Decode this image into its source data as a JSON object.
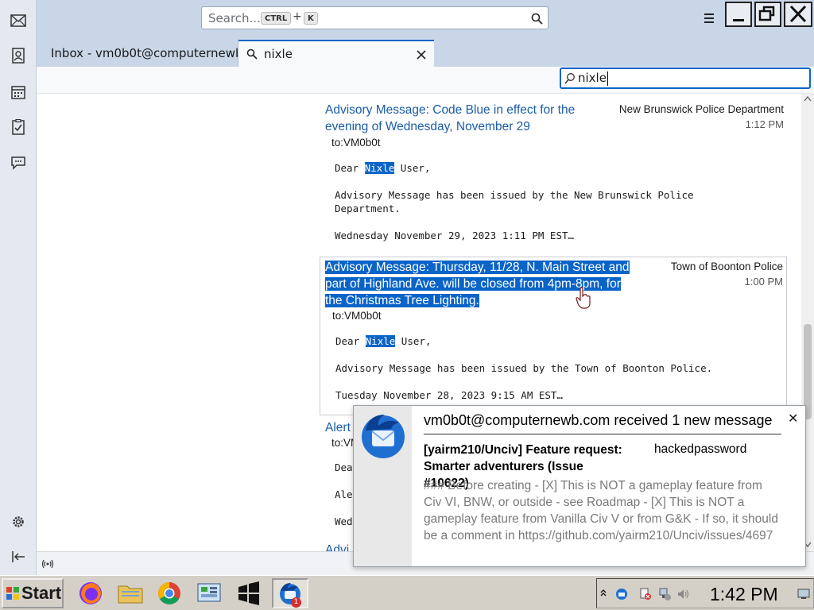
{
  "titlebar": {
    "search_placeholder": "Search...",
    "shortcut_ctrl": "CTRL",
    "shortcut_plus": "+",
    "shortcut_k": "K"
  },
  "tabs": [
    {
      "label": "Inbox - vm0b0t@computernewb.com"
    },
    {
      "label": "nixle"
    }
  ],
  "filter": {
    "value": "nixle"
  },
  "messages": [
    {
      "subject_lines": [
        "Advisory Message: Code Blue in effect for the",
        "evening of Wednesday, November 29"
      ],
      "sender": "New Brunswick Police Department",
      "time": "1:12 PM",
      "to": "to:VM0b0t",
      "body_greeting_pre": "Dear ",
      "body_greeting_hl": "Nixle",
      "body_greeting_post": " User,",
      "body_line1": "Advisory Message has been issued by the New Brunswick Police",
      "body_line2": "Department.",
      "body_line3": "Wednesday November 29, 2023 1:11 PM EST…"
    },
    {
      "subject_lines": [
        "Advisory Message: Thursday, 11/28, N. Main Street and",
        "part of Highland Ave. will be closed from 4pm-8pm, for",
        "the Christmas Tree Lighting."
      ],
      "sender": "Town of Boonton Police",
      "time": "1:00 PM",
      "to": "to:VM0b0t",
      "body_greeting_pre": "Dear ",
      "body_greeting_hl": "Nixle",
      "body_greeting_post": " User,",
      "body_line1": "Advisory Message has been issued by the Town of Boonton Police.",
      "body_line3": "Tuesday November 28, 2023 9:15 AM EST…"
    },
    {
      "subject": "Alert",
      "to": "to:VM0b0t",
      "body_a": "Dea",
      "body_b": "Ale",
      "body_c": "Wed",
      "subject_next": "Advi"
    }
  ],
  "notification": {
    "title": "vm0b0t@computernewb.com received 1 new message",
    "subject": "[yairm210/Unciv] Feature request: Smarter adventurers (Issue #10622)",
    "from": "hackedpassword",
    "body": "### Before creating - [X] This is NOT a gameplay feature from Civ VI, BNW, or outside - see Roadmap - [X] This is NOT a gameplay feature from Vanilla Civ V or from G&K - If so, it should be a comment in https://github.com/yairm210/Unciv/issues/4697",
    "close": "✕"
  },
  "taskbar": {
    "start_label": "Start",
    "clock": "1:42 PM",
    "thunderbird_badge": "1"
  },
  "colors": {
    "accent": "#0a64c8",
    "link": "#1a5ca8",
    "titlebar": "#c9d6e8"
  }
}
